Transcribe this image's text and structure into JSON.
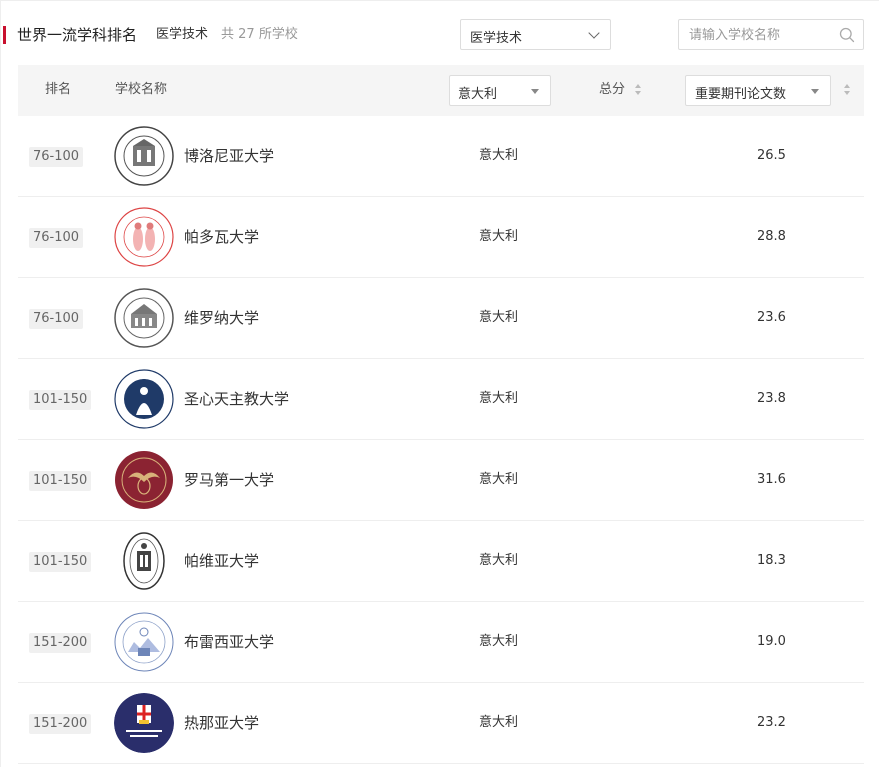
{
  "header": {
    "title": "世界一流学科排名",
    "subject": "医学技术",
    "count_prefix": "共",
    "count_value": "27",
    "count_suffix": "所学校",
    "accent_color": "#c8102e"
  },
  "filters": {
    "subject_select_value": "医学技术",
    "search_placeholder": "请输入学校名称"
  },
  "table": {
    "headers": {
      "rank": "排名",
      "name": "学校名称",
      "country_filter": "意大利",
      "total": "总分",
      "indicator": "重要期刊论文数"
    },
    "rows": [
      {
        "rank": "76-100",
        "name": "博洛尼亚大学",
        "country": "意大利",
        "score": "26.5",
        "logo": "university-of-bologna-seal"
      },
      {
        "rank": "76-100",
        "name": "帕多瓦大学",
        "country": "意大利",
        "score": "28.8",
        "logo": "university-of-padua-seal"
      },
      {
        "rank": "76-100",
        "name": "维罗纳大学",
        "country": "意大利",
        "score": "23.6",
        "logo": "university-of-verona-seal"
      },
      {
        "rank": "101-150",
        "name": "圣心天主教大学",
        "country": "意大利",
        "score": "23.8",
        "logo": "catholic-university-seal"
      },
      {
        "rank": "101-150",
        "name": "罗马第一大学",
        "country": "意大利",
        "score": "31.6",
        "logo": "sapienza-seal"
      },
      {
        "rank": "101-150",
        "name": "帕维亚大学",
        "country": "意大利",
        "score": "18.3",
        "logo": "university-of-pavia-seal"
      },
      {
        "rank": "151-200",
        "name": "布雷西亚大学",
        "country": "意大利",
        "score": "19.0",
        "logo": "university-of-brescia-seal"
      },
      {
        "rank": "151-200",
        "name": "热那亚大学",
        "country": "意大利",
        "score": "23.2",
        "logo": "university-of-genoa-logo"
      }
    ]
  }
}
